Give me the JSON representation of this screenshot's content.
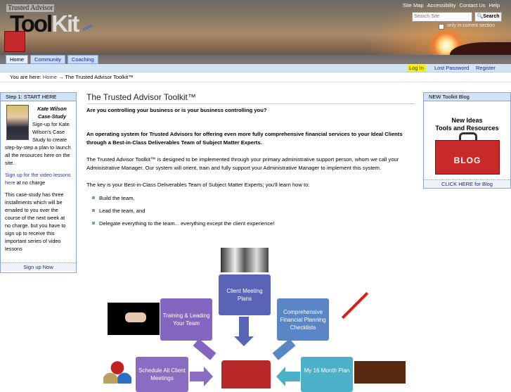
{
  "header": {
    "logo_top": "Trusted Advisor",
    "logo_main_a": "Tool",
    "logo_main_b": "Kit",
    "logo_com": ".com",
    "top_links": [
      "Site Map",
      "Accessibility",
      "Contact Us",
      "Help"
    ],
    "search_placeholder": "Search Site",
    "search_button": "Search",
    "search_checkbox_label": "only in current section"
  },
  "tabs": [
    "Home",
    "Community",
    "Coaching"
  ],
  "user_bar": {
    "login": "Log In",
    "lost_password": "Lost Password",
    "register": "Register"
  },
  "breadcrumb": {
    "prefix": "You are here:",
    "home": "Home",
    "sep": "→",
    "current": "The Trusted Advisor Toolkit™"
  },
  "left_portlet": {
    "title": "Step 1: START HERE",
    "name": "Kate Wilson",
    "subtitle": "Case-Study",
    "intro": "Sign-up for Kate Wilson's Case Study to create step-by-step a plan to launch all the resources here on the site.",
    "link": "Sign up for the video lessons here",
    "link_suffix": " at no charge",
    "body": "This case-study has three installments which will be emailed to you over the course of the next week at no charge. but you have to sign up to receive this important series of video lessons",
    "footer": "Sign up Now"
  },
  "right_portlet": {
    "title": "NEW Toolkit Blog",
    "image_text_1": "New Ideas",
    "image_text_2": "Tools and Resources",
    "image_label": "BLOG",
    "footer": "CLICK HERE for Blog"
  },
  "main": {
    "title": "The Trusted Advisor Toolkit™",
    "tagline": "Are you controlling your business or is your business controlling you?",
    "lead": "An operating system for Trusted Advisors for offering even more fully comprehensive financial services to your Ideal Clients through a Best-in-Class Deliverables Team of Subject Matter Experts.",
    "para1": "The Trusted Advisor Toolkit™ is designed to be implemented through your primary administrative support person, whom we call your Administrative Manager.  Our system will orient, train and fully support your Administrative Manager to implement this system.",
    "para2": "The key is your Best-in-Class Deliverables Team of Subject Matter Experts; you'll learn how to:",
    "bullets": [
      "Build the team,",
      "Lead the team, and",
      "Delegate everything to the team... everything except the client experience!"
    ]
  },
  "diagram": {
    "client_meeting": "Client Meeting Plans",
    "training": "Training & Leading Your Team",
    "comprehensive": "Comprehensive Financial Planning Checklists",
    "schedule": "Schedule All Client Meetings",
    "plan": "My 16 Month Plan"
  }
}
